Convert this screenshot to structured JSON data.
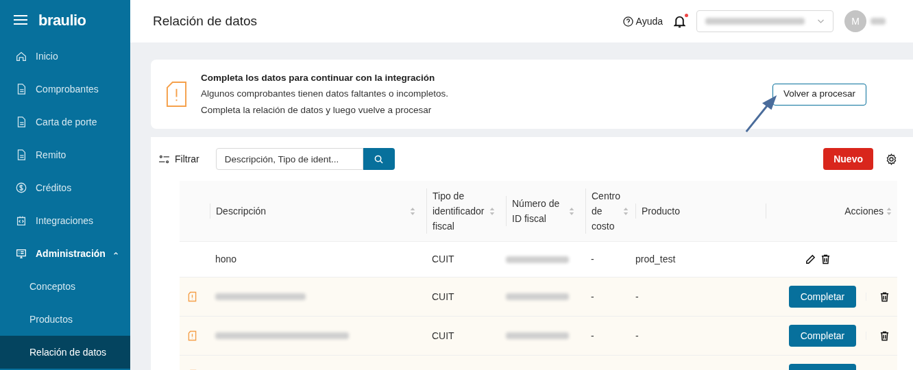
{
  "brand": "braulio",
  "sidebar": {
    "items": [
      {
        "label": "Inicio",
        "kind": "home",
        "selected": false
      },
      {
        "label": "Comprobantes",
        "kind": "doc",
        "selected": false
      },
      {
        "label": "Carta de porte",
        "kind": "doc",
        "selected": false
      },
      {
        "label": "Remito",
        "kind": "doc",
        "selected": false
      },
      {
        "label": "Créditos",
        "kind": "dollar",
        "selected": false
      },
      {
        "label": "Integraciones",
        "kind": "code",
        "selected": false
      },
      {
        "label": "Administración",
        "kind": "monitor",
        "selected": false,
        "expanded": true,
        "children": [
          {
            "label": "Conceptos",
            "selected": false
          },
          {
            "label": "Productos",
            "selected": false
          },
          {
            "label": "Relación de datos",
            "selected": true
          }
        ]
      }
    ]
  },
  "header": {
    "title": "Relación de datos",
    "help": "Ayuda",
    "notification_dot": true,
    "avatar": "M"
  },
  "banner": {
    "title": "Completa los datos para continuar con la integración",
    "lines": [
      "Algunos comprobantes tienen datos faltantes o incompletos.",
      "Completa la relación de datos y luego vuelve a procesar"
    ],
    "button": "Volver a procesar"
  },
  "toolbar": {
    "filter": "Filtrar",
    "search": {
      "placeholder": "Descripción, Tipo de ident..."
    },
    "new_button": "Nuevo"
  },
  "table": {
    "columns": [
      {
        "label": "Descripción",
        "sortable": true
      },
      {
        "label": "Tipo de identificador fiscal",
        "sortable": true
      },
      {
        "label": "Número de ID fiscal",
        "sortable": true
      },
      {
        "label": "Centro de costo",
        "sortable": true
      },
      {
        "label": "Producto",
        "sortable": false
      },
      {
        "label": "Acciones",
        "sortable": true
      }
    ],
    "rows": [
      {
        "kind": "complete",
        "description": "hono",
        "id_type": "CUIT",
        "cost_center": "-",
        "product": "prod_test"
      },
      {
        "kind": "incomplete",
        "id_type": "CUIT",
        "cost_center": "-",
        "product": "-",
        "action": "Completar"
      },
      {
        "kind": "incomplete",
        "id_type": "CUIT",
        "cost_center": "-",
        "product": "-",
        "action": "Completar"
      },
      {
        "kind": "incomplete"
      }
    ]
  }
}
